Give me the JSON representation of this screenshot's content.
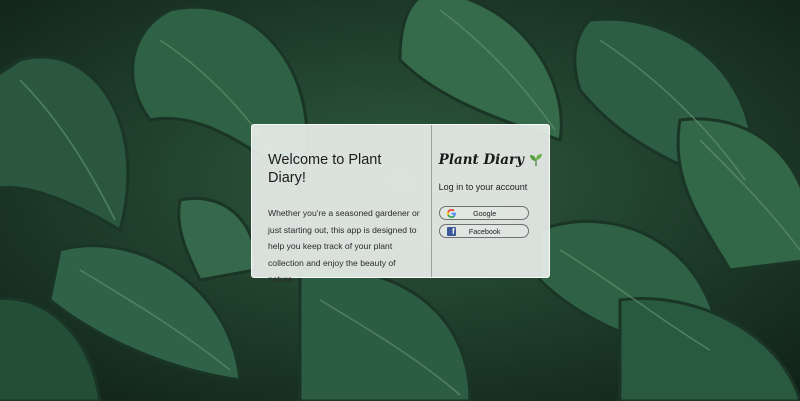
{
  "background": {
    "image": "monstera-leaves"
  },
  "welcome": {
    "title": "Welcome to Plant Diary!",
    "description": "Whether you're a seasoned gardener or just starting out, this app is designed to help you keep track of your plant collection and enjoy the beauty of nature."
  },
  "brand": {
    "name": "Plant Diary",
    "icon": "seedling-icon"
  },
  "login": {
    "prompt": "Log in to your account",
    "google_label": "Google",
    "facebook_label": "Facebook"
  },
  "colors": {
    "google_blue": "#4285F4",
    "google_red": "#EA4335",
    "google_yellow": "#FBBC05",
    "google_green": "#34A853",
    "facebook_blue": "#3b5998",
    "leaf_green": "#4a8f3a"
  }
}
